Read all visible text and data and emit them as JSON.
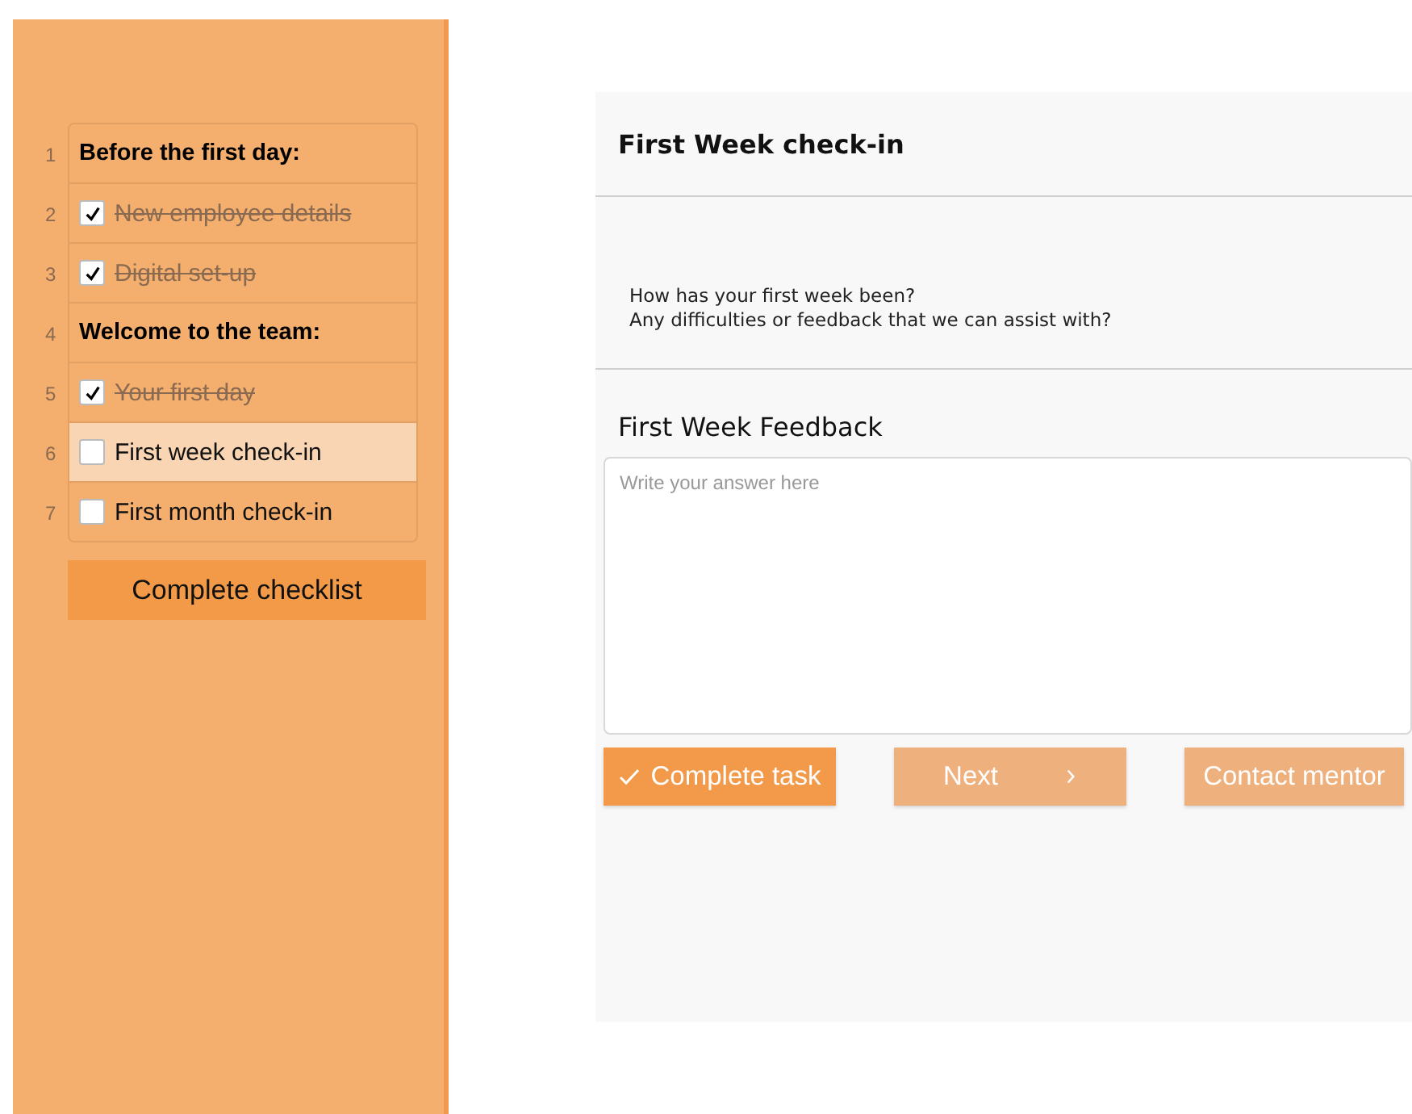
{
  "checklist": {
    "items": [
      {
        "number": "1",
        "kind": "heading",
        "label": "Before the first day:"
      },
      {
        "number": "2",
        "kind": "task",
        "label": "New employee details",
        "checked": true,
        "selected": false
      },
      {
        "number": "3",
        "kind": "task",
        "label": "Digital set-up",
        "checked": true,
        "selected": false
      },
      {
        "number": "4",
        "kind": "heading",
        "label": "Welcome to the team:"
      },
      {
        "number": "5",
        "kind": "task",
        "label": "Your first day",
        "checked": true,
        "selected": false
      },
      {
        "number": "6",
        "kind": "task",
        "label": "First week check-in",
        "checked": false,
        "selected": true
      },
      {
        "number": "7",
        "kind": "task",
        "label": "First month check-in",
        "checked": false,
        "selected": false
      }
    ],
    "button": "Complete checklist"
  },
  "task": {
    "title": "First Week check-in",
    "description": [
      "How has your first week been?",
      "Any difficulties or feedback that we can assist with?"
    ],
    "field_label": "First Week Feedback",
    "placeholder": "Write your answer here",
    "buttons": [
      {
        "label": "Complete task",
        "kind": "complete"
      },
      {
        "label": "Next",
        "kind": "next"
      },
      {
        "label": "Contact mentor",
        "kind": "contact"
      }
    ]
  }
}
